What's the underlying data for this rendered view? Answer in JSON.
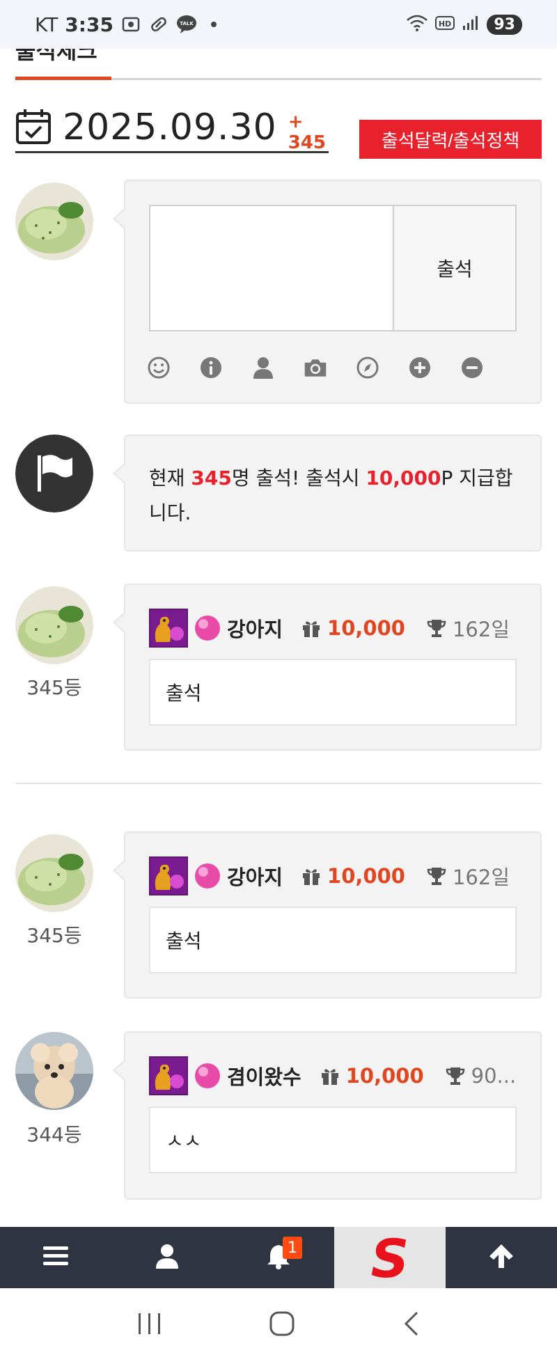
{
  "status_bar": {
    "carrier": "KT",
    "time": "3:35",
    "talk_label": "TALK",
    "hd_label": "HD",
    "battery": "93"
  },
  "page": {
    "tab_title": "출석체크",
    "date": "2025.09.30",
    "count_delta": "+ 345",
    "policy_button": "출석달력/출석정책"
  },
  "compose": {
    "submit_label": "출석",
    "tools": [
      "smile-icon",
      "info-icon",
      "user-icon",
      "camera-icon",
      "compass-icon",
      "plus-circle-icon",
      "minus-circle-icon"
    ]
  },
  "notice": {
    "prefix": "현재 ",
    "count": "345",
    "middle": "명 출석! 출석시 ",
    "points": "10,000",
    "suffix": "P 지급합니다."
  },
  "entries": [
    {
      "rank": "345등",
      "nickname": "강아지",
      "points": "10,000",
      "days": "162일",
      "comment": "출석"
    },
    {
      "rank": "345등",
      "nickname": "강아지",
      "points": "10,000",
      "days": "162일",
      "comment": "출석"
    },
    {
      "rank": "344등",
      "nickname": "겸이왔수",
      "points": "10,000",
      "days": "90...",
      "comment": "ㅅㅅ"
    }
  ],
  "bottom_nav": {
    "notification_count": "1",
    "logo_letter": "S"
  },
  "colors": {
    "accent_red": "#e8212c",
    "accent_orange": "#e0461f",
    "nav_bg": "#2e3540"
  }
}
